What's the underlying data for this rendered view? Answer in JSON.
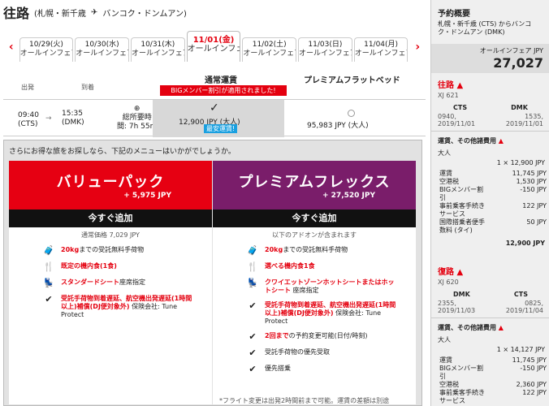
{
  "header": {
    "title": "往路",
    "route": "(札幌・新千歳",
    "plane_icon": "plane-icon",
    "route_to": "バンコク・ドンムアン)"
  },
  "dates": {
    "prev_icon": "chevron-left-icon",
    "next_icon": "chevron-right-icon",
    "tabs": [
      {
        "date": "10/29(火)",
        "fare": "オールインフェア"
      },
      {
        "date": "10/30(水)",
        "fare": "オールインフェア"
      },
      {
        "date": "10/31(木)",
        "fare": "オールインフェア"
      },
      {
        "date": "11/01(金)",
        "fare": "オールインフェア"
      },
      {
        "date": "11/02(土)",
        "fare": "オールインフェア"
      },
      {
        "date": "11/03(日)",
        "fare": "オールインフェア"
      },
      {
        "date": "11/04(月)",
        "fare": "オールインフェア"
      }
    ]
  },
  "columns": {
    "depart": "出発",
    "arrive": "到着",
    "standard": "通常運賃",
    "premium": "プレミアムフラットベッド",
    "banner": "BIGメンバー割引が適用されました!"
  },
  "flight": {
    "dep_time": "09:40",
    "dep_code": "(CTS)",
    "arr_time": "15:35",
    "arr_code": "(DMK)",
    "dur_label": "総所要時",
    "dur_value": "間: 7h 55m",
    "std_price": "12,900 JPY (大人)",
    "std_badge": "最安運賃!",
    "prem_price": "95,983 JPY (大人)"
  },
  "upsell": {
    "question": "さらにお得な旅をお探しなら、下記のメニューはいかがでしょうか。",
    "value": {
      "name": "バリューパック",
      "price": "+ 5,975 JPY",
      "add": "今すぐ追加",
      "note": "通常価格 7,029 JPY",
      "features": [
        {
          "icon": "baggage-icon",
          "b": "20kg",
          "t": "までの受託無料手荷物"
        },
        {
          "icon": "meal-icon",
          "b": "既定の機内食(1食)",
          "t": ""
        },
        {
          "icon": "seat-icon",
          "b": "スタンダードシート",
          "t": "座席指定"
        },
        {
          "icon": "check-icon",
          "b": "受託手荷物到着遅延、航空機出発遅延(1時間以上)補償(DJ便対象外)",
          "t": " 保険会社: Tune Protect"
        }
      ]
    },
    "flex": {
      "name": "プレミアムフレックス",
      "price": "+ 27,520 JPY",
      "add": "今すぐ追加",
      "note": "以下のアドオンが含まれます",
      "features": [
        {
          "icon": "baggage-icon",
          "b": "20kg",
          "t": "までの受託無料手荷物"
        },
        {
          "icon": "meal-icon",
          "b": "選べる機内食1食",
          "t": ""
        },
        {
          "icon": "seat-icon",
          "b": "クワイエットゾーンホットシートまたはホットシート",
          "t": " 座席指定"
        },
        {
          "icon": "check-icon",
          "b": "受託手荷物到着遅延、航空機出発遅延(1時間以上)補償(DJ便対象外)",
          "t": " 保険会社: Tune Protect"
        },
        {
          "icon": "check-icon",
          "b": "2回まで",
          "t": "の予約変更可能(日付/時刻)"
        },
        {
          "icon": "check-icon",
          "b": "",
          "t": "受託手荷物の優先受取"
        },
        {
          "icon": "check-icon",
          "b": "",
          "t": "優先搭乗"
        }
      ]
    },
    "footnote": "*フライト変更は出発2時間前まで可能。運賃の差額は別途"
  },
  "summary": {
    "title": "予約概要",
    "route": "札幌・新千歳 (CTS) からバンコク・ドンムアン (DMK)",
    "fare_name": "オールインフェア JPY",
    "total": "27,027",
    "outbound": {
      "title": "往路",
      "flight": "XJ 621",
      "from": "CTS",
      "to": "DMK",
      "dep": "0940, 2019/11/01",
      "arr": "1535, 2019/11/01",
      "sub": "運賃、その他諸費用",
      "pax": "大人",
      "line": "1 × 12,900 JPY",
      "items": [
        {
          "k": "運賃",
          "v": "11,745 JPY"
        },
        {
          "k": "空港税",
          "v": "1,530 JPY"
        },
        {
          "k": "BIGメンバー割引",
          "v": "-150 JPY"
        },
        {
          "k": "事前乗客手続きサービス",
          "v": "122 JPY"
        },
        {
          "k": "国際搭乗者便手数料 (タイ)",
          "v": "50 JPY"
        }
      ],
      "subtotal": "12,900 JPY"
    },
    "inbound": {
      "title": "復路",
      "flight": "XJ 620",
      "from": "DMK",
      "to": "CTS",
      "dep": "2355, 2019/11/03",
      "arr": "0825, 2019/11/04",
      "sub": "運賃、その他諸費用",
      "pax": "大人",
      "line": "1 × 14,127 JPY",
      "items": [
        {
          "k": "運賃",
          "v": "11,745 JPY"
        },
        {
          "k": "BIGメンバー割引",
          "v": "-150 JPY"
        },
        {
          "k": "空港税",
          "v": "2,360 JPY"
        },
        {
          "k": "事前乗客手続きサービス",
          "v": "122 JPY"
        }
      ]
    }
  }
}
